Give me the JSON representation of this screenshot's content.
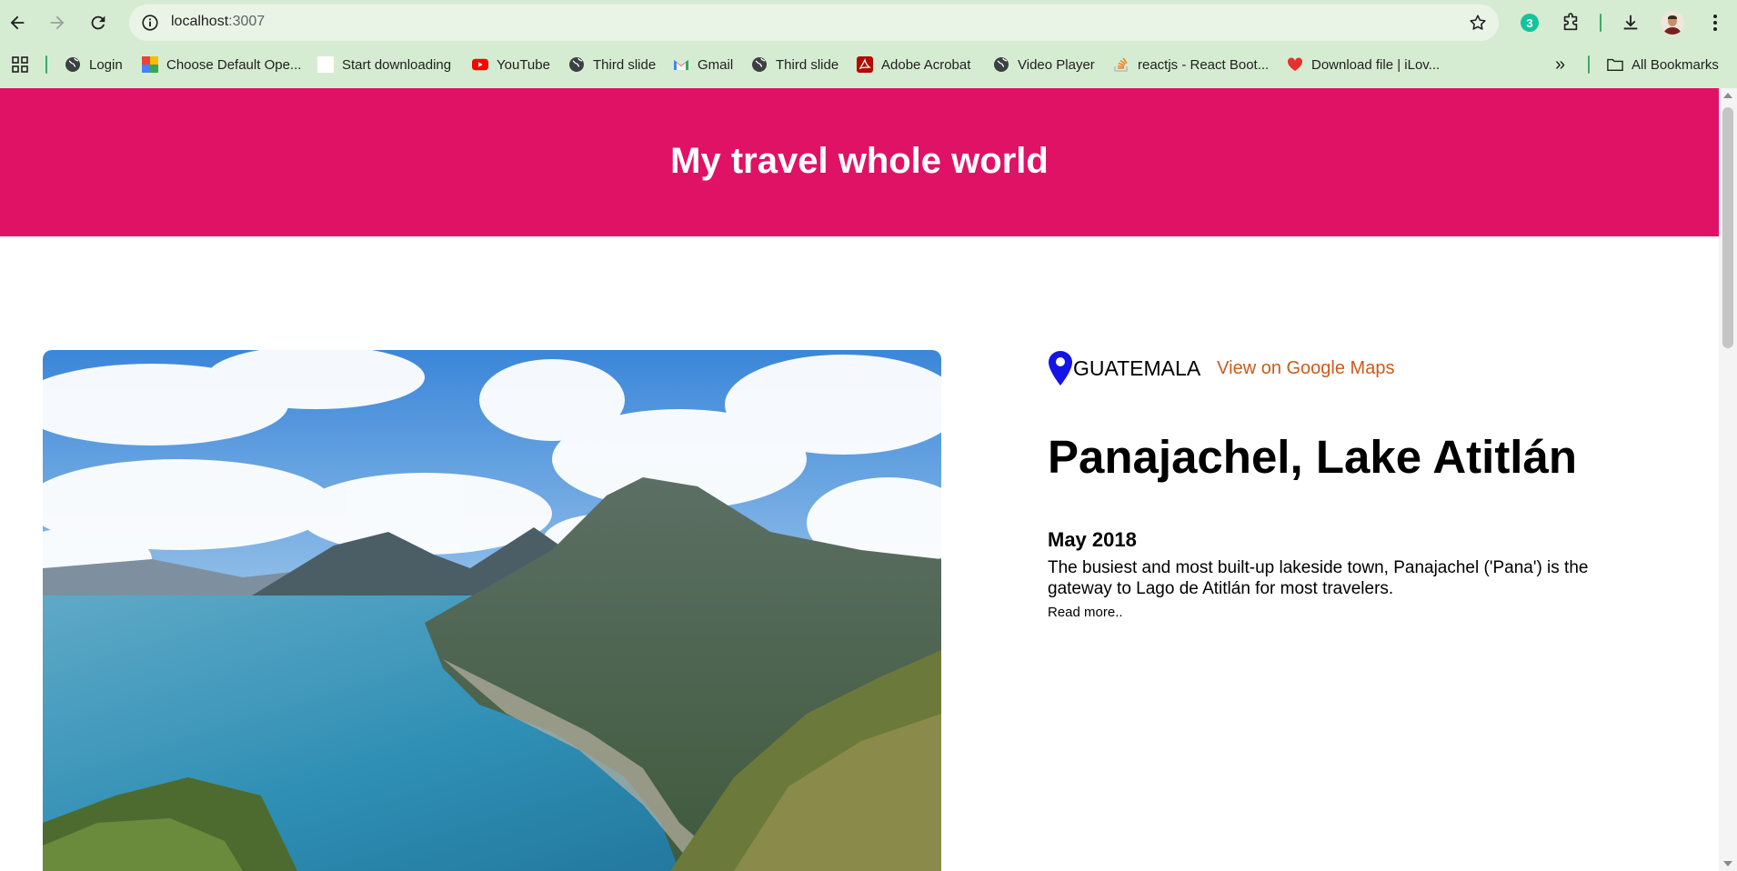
{
  "browser": {
    "url_host": "localhost",
    "url_port": ":3007",
    "extension_badge": "3",
    "bookmarks": [
      {
        "label": "Login",
        "icon": "globe-icon"
      },
      {
        "label": "Choose Default Ope...",
        "icon": "colorful-app-icon"
      },
      {
        "label": "Start downloading",
        "icon": "blank-page-icon"
      },
      {
        "label": "YouTube",
        "icon": "youtube-icon"
      },
      {
        "label": "Third slide",
        "icon": "globe-icon"
      },
      {
        "label": "Gmail",
        "icon": "gmail-icon"
      },
      {
        "label": "Third slide",
        "icon": "globe-icon"
      },
      {
        "label": "Adobe Acrobat",
        "icon": "acrobat-icon"
      },
      {
        "label": "Video Player",
        "icon": "globe-icon"
      },
      {
        "label": "reactjs - React Boot...",
        "icon": "stackoverflow-icon"
      },
      {
        "label": "Download file | iLov...",
        "icon": "heart-icon"
      }
    ],
    "overflow_label": "»",
    "all_bookmarks_label": "All Bookmarks"
  },
  "page": {
    "header_title": "My travel whole world",
    "entry": {
      "country": "GUATEMALA",
      "maps_link": "View on Google Maps",
      "title": "Panajachel, Lake Atitlán",
      "date": "May 2018",
      "description": "The busiest and most built-up lakeside town, Panajachel ('Pana') is the gateway to Lago de Atitlán for most travelers.",
      "read_more": "Read more.."
    }
  },
  "colors": {
    "header_bg": "#e01265",
    "link": "#cc5a1a",
    "pin": "#1414e6",
    "chrome_bg": "#d6ecd2"
  }
}
